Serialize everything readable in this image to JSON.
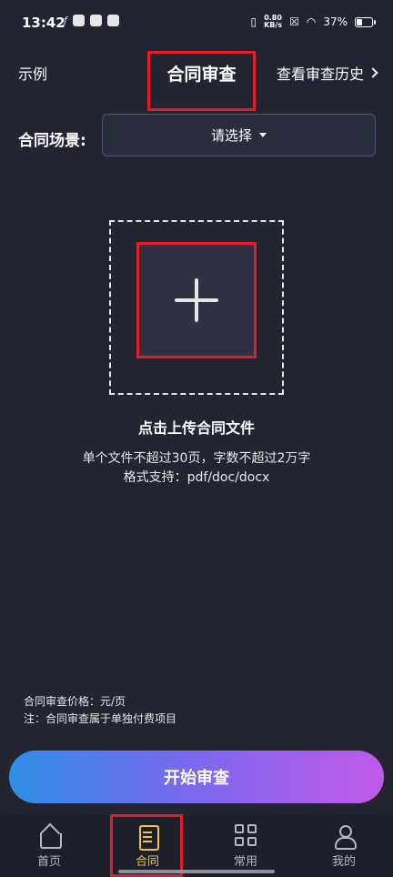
{
  "status_bar": {
    "time": "13:42",
    "net_speed_value": "0.80",
    "net_speed_unit": "KB/s",
    "battery": "37%",
    "battery_level": 0.37
  },
  "header": {
    "example": "示例",
    "title": "合同审查",
    "history": "查看审查历史"
  },
  "scene": {
    "label": "合同场景:",
    "select_value": "请选择"
  },
  "upload": {
    "title": "点击上传合同文件",
    "hint_line1": "单个文件不超过30页，字数不超过2万字",
    "hint_line2": "格式支持：pdf/doc/docx"
  },
  "price": {
    "line1": "合同审查价格：元/页",
    "line2": "注：合同审查属于单独付费项目"
  },
  "start_button": "开始审查",
  "nav": [
    {
      "label": "首页",
      "icon": "home-icon"
    },
    {
      "label": "合同",
      "icon": "doc-icon"
    },
    {
      "label": "常用",
      "icon": "grid-icon"
    },
    {
      "label": "我的",
      "icon": "user-icon"
    }
  ],
  "colors": {
    "background": "#222432",
    "highlight_red": "#e41c2a",
    "active_nav": "#f0c34a",
    "button_gradient": [
      "#2f8fe6",
      "#c15ae8"
    ]
  }
}
